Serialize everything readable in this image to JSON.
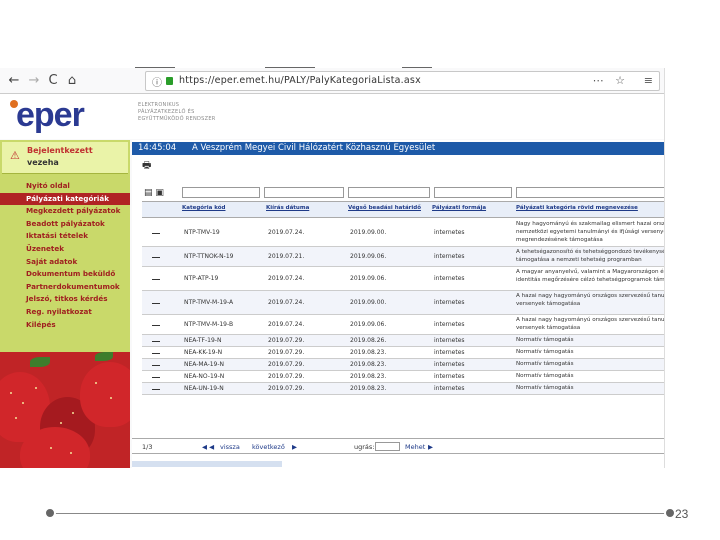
{
  "browser": {
    "url": "https://eper.emet.hu/PALY/PalyKategoriaLista.asx"
  },
  "header": {
    "logo": "eper",
    "tagline": "ELEKTRONIKUS PÁLYÁZATKEZELŐ ÉS EGYÜTTMŰKÖDŐ RENDSZER"
  },
  "sidebar": {
    "welcome_line1": "Bejelentkezett",
    "welcome_line2": "vezeha",
    "items": [
      {
        "label": "Nyitó oldal",
        "active": false
      },
      {
        "label": "Pályázati kategóriák",
        "active": true
      },
      {
        "label": "Megkezdett pályázatok",
        "active": false
      },
      {
        "label": "Beadott pályázatok",
        "active": false
      },
      {
        "label": "Iktatási tételek",
        "active": false
      },
      {
        "label": "Üzenetek",
        "active": false
      },
      {
        "label": "Saját adatok",
        "active": false
      },
      {
        "label": "Dokumentum beküldő",
        "active": false
      },
      {
        "label": "Partnerdokumentumok",
        "active": false
      },
      {
        "label": "Jelszó, titkos kérdés",
        "active": false
      },
      {
        "label": "Reg. nyilatkozat",
        "active": false
      },
      {
        "label": "Kilépés",
        "active": false
      }
    ]
  },
  "main": {
    "time": "14:45:04",
    "organization": "A Veszprém Megyei Civil Hálózatért Közhasznú Egyesület",
    "columns": [
      "Kategória kód",
      "Kiírás dátuma",
      "Végső beadási határidő",
      "Pályázati formája",
      "Pályázati kategória rövid megnevezése"
    ],
    "rows": [
      {
        "code": "NTP-TMV-19",
        "date": "2019.07.24.",
        "deadline": "2019.09.00.",
        "form": "internetes",
        "desc": "Nagy hagyományú és szakmailag elismert hazai országos, vagy nemzetközi egyetemi tanulmányi és ifjúsági versenyek megrendezésének támogatása"
      },
      {
        "code": "NTP-TTNOK-N-19",
        "date": "2019.07.21.",
        "deadline": "2019.09.06.",
        "form": "internetes",
        "desc": "A tehetségazonosító és tehetséggondozó tevékenységek kormányzati támogatása a nemzeti tehetség programban"
      },
      {
        "code": "NTP-ATP-19",
        "date": "2019.07.24.",
        "deadline": "2019.09.06.",
        "form": "internetes",
        "desc": "A magyar anyanyelvű, valamint a Magyarországon élő nemzetiségek identitás megőrzésére célzó tehetségprogramok támogatása"
      },
      {
        "code": "NTP-TMV-M-19-A",
        "date": "2019.07.24.",
        "deadline": "2019.09.00.",
        "form": "internetes",
        "desc": "A hazai nagy hagyományú országos szervezésű tanulmányi és sport versenyek támogatása"
      },
      {
        "code": "NTP-TMV-M-19-B",
        "date": "2019.07.24.",
        "deadline": "2019.09.06.",
        "form": "internetes",
        "desc": "A hazai nagy hagyományú országos szervezésű tanulmányi és sport versenyek támogatása"
      },
      {
        "code": "NEA-TF-19-N",
        "date": "2019.07.29.",
        "deadline": "2019.08.26.",
        "form": "internetes",
        "desc": "Normatív támogatás"
      },
      {
        "code": "NEA-KK-19-N",
        "date": "2019.07.29.",
        "deadline": "2019.08.23.",
        "form": "internetes",
        "desc": "Normatív támogatás"
      },
      {
        "code": "NEA-MA-19-N",
        "date": "2019.07.29.",
        "deadline": "2019.08.23.",
        "form": "internetes",
        "desc": "Normatív támogatás"
      },
      {
        "code": "NEA-NO-19-N",
        "date": "2019.07.29.",
        "deadline": "2019.08.23.",
        "form": "internetes",
        "desc": "Normatív támogatás"
      },
      {
        "code": "NEA-UN-19-N",
        "date": "2019.07.29.",
        "deadline": "2019.08.23.",
        "form": "internetes",
        "desc": "Normatív támogatás"
      }
    ],
    "pager": {
      "page": "1/3",
      "prev": "vissza",
      "next": "következő",
      "goto_label": "ugrás:",
      "go": "Mehet"
    }
  },
  "slide": {
    "page_number": "23"
  },
  "colors": {
    "title_bar": "#1e5aa8",
    "sidebar": "#c9d96a",
    "active_menu": "#b02424"
  }
}
